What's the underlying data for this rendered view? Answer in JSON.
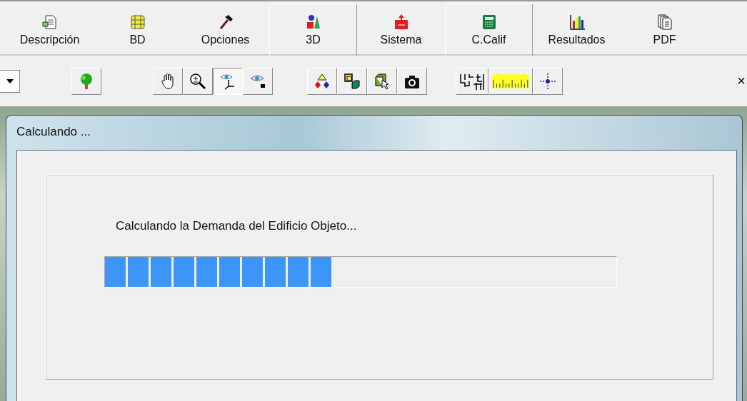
{
  "tabs": [
    {
      "label": "Descripción",
      "raised": false
    },
    {
      "label": "BD",
      "raised": false
    },
    {
      "label": "Opciones",
      "raised": false
    },
    {
      "label": "3D",
      "raised": true
    },
    {
      "label": "Sistema",
      "raised": false
    },
    {
      "label": "C.Calif",
      "raised": true
    },
    {
      "label": "Resultados",
      "raised": false
    },
    {
      "label": "PDF",
      "raised": false
    }
  ],
  "toolbar": {
    "close": "×",
    "groups": [
      [
        {
          "pressed": false
        }
      ],
      [
        {
          "pressed": false
        },
        {
          "pressed": false
        },
        {
          "pressed": true
        },
        {
          "pressed": false
        }
      ],
      [
        {
          "pressed": false
        },
        {
          "pressed": false
        },
        {
          "pressed": false
        },
        {
          "pressed": false
        }
      ],
      [
        {
          "pressed": false
        },
        {
          "pressed": false
        },
        {
          "pressed": false
        }
      ]
    ]
  },
  "dialog": {
    "title": "Calculando ...",
    "message": "Calculando la Demanda del Edificio Objeto...",
    "progress": {
      "level": 0.445
    }
  }
}
